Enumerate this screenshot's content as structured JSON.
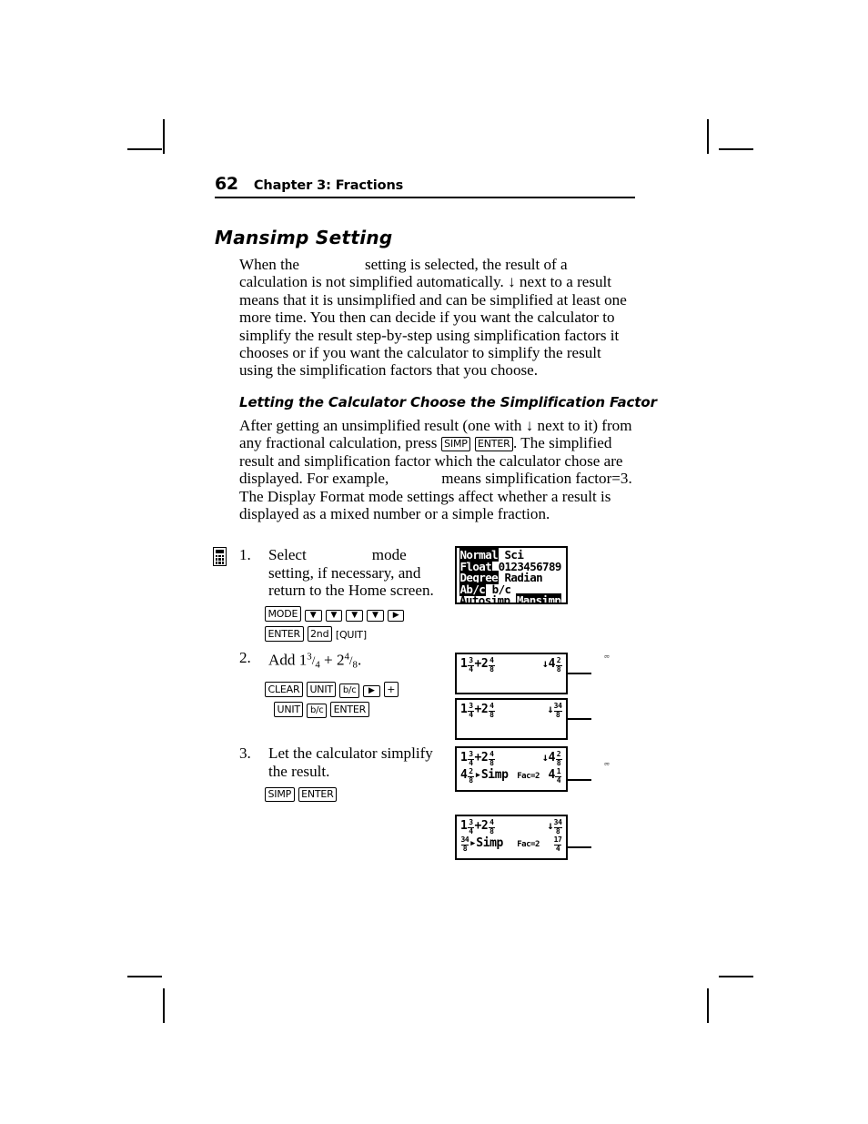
{
  "page": {
    "number": "62",
    "chapter": "Chapter 3: Fractions"
  },
  "section": {
    "heading": "Mansimp Setting",
    "intro_parts": {
      "before": "When the",
      "after": "setting is selected, the result of a calculation is not simplified automatically. ↓ next to a result means that it is unsimplified and can be simplified at least one more time. You then can decide if you want the calculator to simplify the result step-by-step using simplification factors it chooses or if you want the calculator to simplify the result using the simplification factors that you choose."
    }
  },
  "subsection": {
    "heading": "Letting the Calculator Choose the Simplification Factor",
    "para_1": "After getting an unsimplified result (one with ↓ next to it) from any fractional calculation, press",
    "key_simp": "SIMP",
    "key_enter": "ENTER",
    "para_2": ". The simplified result and simplification factor which the calculator chose are displayed. For example,",
    "para_3": "means simplification factor=3. The Display Format mode settings affect whether a result is displayed as a mixed number or a simple fraction."
  },
  "steps": [
    {
      "number": "1.",
      "text_before": "Select",
      "text_after": "mode setting, if necessary, and return to the Home screen.",
      "keys_line1": [
        "MODE",
        "▼",
        "▼",
        "▼",
        "▼",
        "▶"
      ],
      "keys_line2": [
        "ENTER",
        "2nd"
      ],
      "keys_line2_bracket": "[QUIT]"
    },
    {
      "number": "2.",
      "text": "Add 1 3/4 + 2 4/8.",
      "add_whole_1": "1",
      "add_num_1": "3",
      "add_den_1": "4",
      "add_plus": "+",
      "add_whole_2": "2",
      "add_num_2": "4",
      "add_den_2": "8",
      "add_period": ".",
      "keys_line1": [
        "CLEAR",
        "UNIT",
        "b/c",
        "▶",
        "+"
      ],
      "keys_line2": [
        "UNIT",
        "b/c",
        "ENTER"
      ]
    },
    {
      "number": "3.",
      "text": "Let the calculator simplify the result.",
      "keys_line1": [
        "SIMP",
        "ENTER"
      ]
    }
  ],
  "mode_screen": {
    "name": "mode-settings-screen",
    "rows": [
      {
        "items": [
          {
            "label": "Normal",
            "selected": true
          },
          {
            "label": "Sci",
            "selected": false
          }
        ]
      },
      {
        "items": [
          {
            "label": "Float",
            "selected": true
          },
          {
            "label": "0123456789",
            "selected": false
          }
        ]
      },
      {
        "items": [
          {
            "label": "Degree",
            "selected": true
          },
          {
            "label": "Radian",
            "selected": false
          }
        ]
      },
      {
        "items": [
          {
            "label": "Ab/c",
            "selected": true
          },
          {
            "label": "b/c",
            "selected": false
          }
        ]
      },
      {
        "items": [
          {
            "label": "Autosimp",
            "selected": false
          },
          {
            "label": "Mansimp",
            "selected": true
          }
        ]
      }
    ]
  },
  "home_screens": [
    {
      "name": "step2-screen-mixed",
      "lines": [
        {
          "expr": {
            "whole1": "1",
            "num1": "3",
            "den1": "4",
            "op": "+",
            "whole2": "2",
            "num2": "4",
            "den2": "8"
          },
          "fac": "",
          "result": {
            "arrow": "↓",
            "whole": "4",
            "num": "2",
            "den": "8"
          }
        }
      ]
    },
    {
      "name": "step2-screen-simple",
      "lines": [
        {
          "expr": {
            "whole1": "1",
            "num1": "3",
            "den1": "4",
            "op": "+",
            "whole2": "2",
            "num2": "4",
            "den2": "8"
          },
          "fac": "",
          "result": {
            "arrow": "↓",
            "whole": "",
            "num": "34",
            "den": "8"
          }
        }
      ]
    },
    {
      "name": "step3-screen-mixed",
      "lines": [
        {
          "expr": {
            "whole1": "1",
            "num1": "3",
            "den1": "4",
            "op": "+",
            "whole2": "2",
            "num2": "4",
            "den2": "8"
          },
          "fac": "",
          "result": {
            "arrow": "↓",
            "whole": "4",
            "num": "2",
            "den": "8"
          }
        },
        {
          "simp_whole": "4",
          "simp_num": "2",
          "simp_den": "8",
          "simp_cmd": "▸Simp",
          "fac": "Fac=2",
          "result": {
            "arrow": "",
            "whole": "4",
            "num": "1",
            "den": "4"
          }
        }
      ]
    },
    {
      "name": "step3-screen-simple",
      "lines": [
        {
          "expr": {
            "whole1": "1",
            "num1": "3",
            "den1": "4",
            "op": "+",
            "whole2": "2",
            "num2": "4",
            "den2": "8"
          },
          "fac": "",
          "result": {
            "arrow": "↓",
            "whole": "",
            "num": "34",
            "den": "8"
          }
        },
        {
          "simp_whole": "",
          "simp_num": "34",
          "simp_den": "8",
          "simp_cmd": "▸Simp",
          "fac": "Fac=2",
          "result": {
            "arrow": "",
            "whole": "",
            "num": "17",
            "den": "4"
          }
        }
      ]
    }
  ],
  "stray_marks": [
    "⊔",
    "⊔"
  ],
  "colors": {
    "ink": "#000000",
    "paper": "#ffffff",
    "icon_shadow": "#9a9a9a"
  }
}
